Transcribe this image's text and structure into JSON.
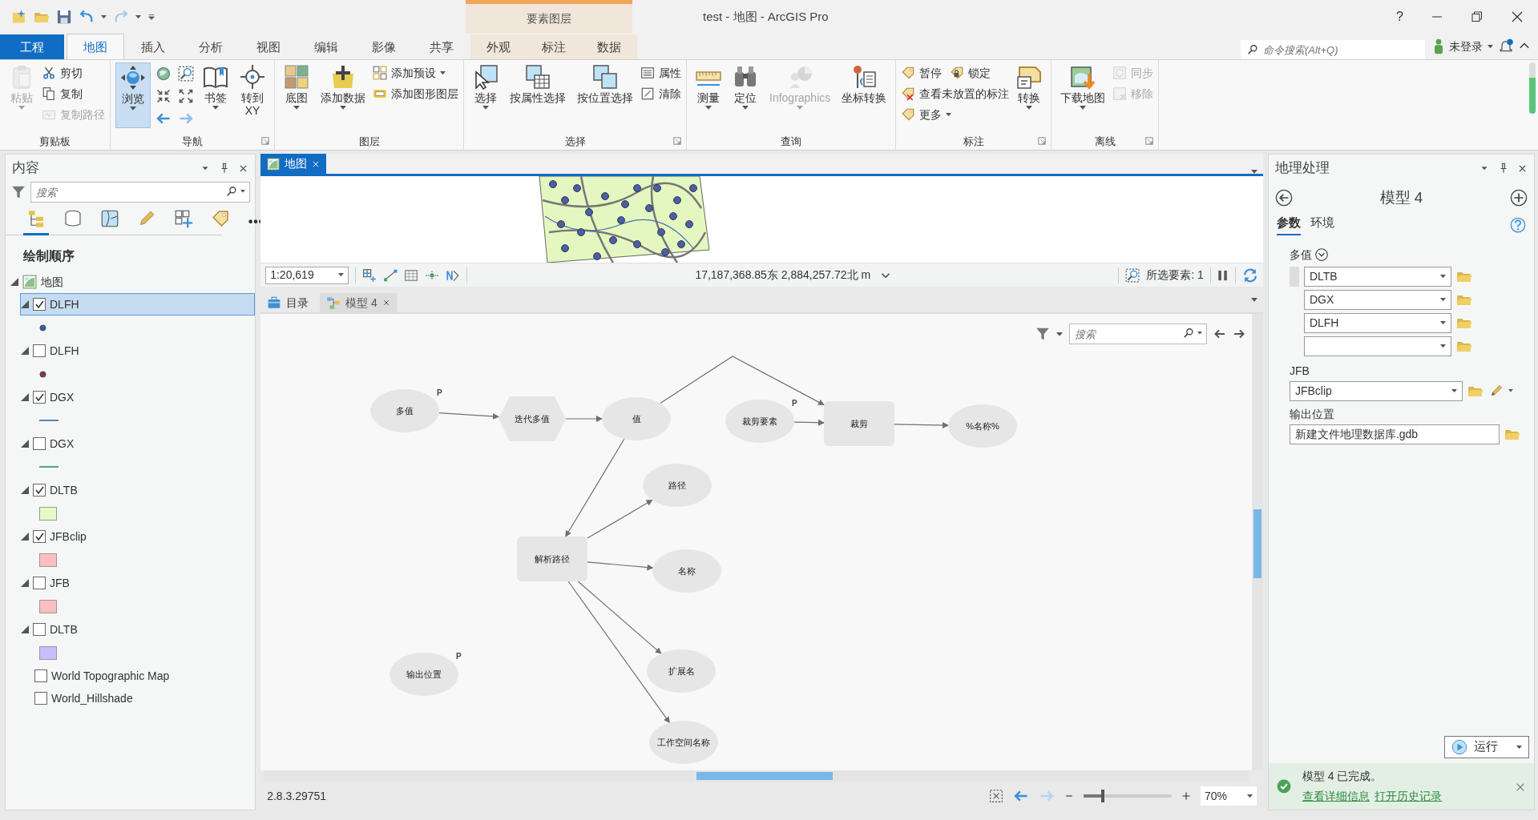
{
  "window": {
    "title": "test - 地图 - ArcGIS Pro",
    "context_group": "要素图层",
    "help": "?"
  },
  "ribbon_tabs": [
    {
      "label": "工程",
      "kind": "file",
      "selected": false
    },
    {
      "label": "地图",
      "kind": "tab",
      "selected": true
    },
    {
      "label": "插入",
      "kind": "tab",
      "selected": false
    },
    {
      "label": "分析",
      "kind": "tab",
      "selected": false
    },
    {
      "label": "视图",
      "kind": "tab",
      "selected": false
    },
    {
      "label": "编辑",
      "kind": "tab",
      "selected": false
    },
    {
      "label": "影像",
      "kind": "tab",
      "selected": false
    },
    {
      "label": "共享",
      "kind": "tab",
      "selected": false
    },
    {
      "label": "外观",
      "kind": "context",
      "selected": false
    },
    {
      "label": "标注",
      "kind": "context",
      "selected": false
    },
    {
      "label": "数据",
      "kind": "context",
      "selected": false
    }
  ],
  "command_search": {
    "placeholder": "命令搜索(Alt+Q)"
  },
  "account": {
    "label": "未登录"
  },
  "ribbon_groups": [
    {
      "title": "剪贴板",
      "launcher": false,
      "columns": [
        {
          "kind": "large",
          "command": {
            "label": "粘贴",
            "disabled": true,
            "active": false,
            "dropdown": true
          }
        },
        {
          "kind": "stack",
          "rows": [
            [
              {
                "label": "剪切",
                "disabled": false,
                "active": false,
                "dropdown": false
              }
            ],
            [
              {
                "label": "复制",
                "disabled": false,
                "active": false,
                "dropdown": false
              }
            ],
            [
              {
                "label": "复制路径",
                "disabled": true,
                "active": false,
                "dropdown": false
              }
            ]
          ]
        }
      ]
    },
    {
      "title": "导航",
      "launcher": true,
      "columns": [
        {
          "kind": "large",
          "command": {
            "label": "浏览",
            "disabled": false,
            "active": true,
            "dropdown": true
          }
        },
        {
          "kind": "grid",
          "items": [
            {
              "disabled": false
            },
            {
              "disabled": false
            },
            {
              "disabled": false
            },
            {
              "disabled": false
            },
            {
              "disabled": false
            },
            {
              "disabled": true
            }
          ]
        },
        {
          "kind": "large",
          "command": {
            "label": "书签",
            "disabled": false,
            "active": false,
            "dropdown": true
          }
        },
        {
          "kind": "large",
          "command": {
            "label": "转到 XY",
            "disabled": false,
            "active": false,
            "dropdown": false
          }
        }
      ]
    },
    {
      "title": "图层",
      "launcher": false,
      "columns": [
        {
          "kind": "large",
          "command": {
            "label": "底图",
            "disabled": false,
            "active": false,
            "dropdown": true
          }
        },
        {
          "kind": "large",
          "command": {
            "label": "添加数据",
            "disabled": false,
            "active": false,
            "dropdown": true
          }
        },
        {
          "kind": "stack",
          "rows": [
            [
              {
                "label": "添加预设",
                "disabled": false,
                "active": false,
                "dropdown": true
              }
            ],
            [
              {
                "label": "添加图形图层",
                "disabled": false,
                "active": false,
                "dropdown": false
              }
            ]
          ]
        }
      ]
    },
    {
      "title": "选择",
      "launcher": true,
      "columns": [
        {
          "kind": "large",
          "command": {
            "label": "选择",
            "disabled": false,
            "active": false,
            "dropdown": true
          }
        },
        {
          "kind": "large",
          "command": {
            "label": "按属性选择",
            "disabled": false,
            "active": false,
            "dropdown": false
          }
        },
        {
          "kind": "large",
          "command": {
            "label": "按位置选择",
            "disabled": false,
            "active": false,
            "dropdown": false
          }
        },
        {
          "kind": "stack",
          "rows": [
            [
              {
                "label": "属性",
                "disabled": false,
                "active": false,
                "dropdown": false
              }
            ],
            [
              {
                "label": "清除",
                "disabled": false,
                "active": false,
                "dropdown": false
              }
            ]
          ]
        }
      ]
    },
    {
      "title": "查询",
      "launcher": false,
      "columns": [
        {
          "kind": "large",
          "command": {
            "label": "测量",
            "disabled": false,
            "active": false,
            "dropdown": true
          }
        },
        {
          "kind": "large",
          "command": {
            "label": "定位",
            "disabled": false,
            "active": false,
            "dropdown": true
          }
        },
        {
          "kind": "large",
          "command": {
            "label": "Infographics",
            "disabled": true,
            "active": false,
            "dropdown": true
          }
        },
        {
          "kind": "large",
          "command": {
            "label": "坐标转换",
            "disabled": false,
            "active": false,
            "dropdown": false
          }
        }
      ]
    },
    {
      "title": "标注",
      "launcher": true,
      "columns": [
        {
          "kind": "stack",
          "rows": [
            [
              {
                "label": "暂停",
                "disabled": false,
                "active": false,
                "dropdown": false
              },
              {
                "label": "锁定",
                "disabled": false,
                "active": false,
                "dropdown": false
              }
            ],
            [
              {
                "label": "查看未放置的标注",
                "disabled": false,
                "active": false,
                "dropdown": false
              }
            ],
            [
              {
                "label": "更多",
                "disabled": false,
                "active": false,
                "dropdown": true
              }
            ]
          ]
        },
        {
          "kind": "large",
          "command": {
            "label": "转换",
            "disabled": false,
            "active": false,
            "dropdown": true
          }
        }
      ]
    },
    {
      "title": "离线",
      "launcher": true,
      "columns": [
        {
          "kind": "large",
          "command": {
            "label": "下载地图",
            "disabled": false,
            "active": false,
            "dropdown": true
          }
        },
        {
          "kind": "stack",
          "rows": [
            [
              {
                "label": "同步",
                "disabled": true,
                "active": false,
                "dropdown": false
              }
            ],
            [
              {
                "label": "移除",
                "disabled": true,
                "active": false,
                "dropdown": false
              }
            ]
          ]
        }
      ]
    }
  ],
  "contents_pane": {
    "title": "内容",
    "search": {
      "placeholder": "搜索"
    },
    "view_tabs": [
      {
        "selected": true
      },
      {
        "selected": false
      },
      {
        "selected": false
      },
      {
        "selected": false
      },
      {
        "selected": false
      },
      {
        "selected": false
      }
    ],
    "heading": "绘制顺序",
    "map": {
      "label": "地图",
      "expanded": true
    },
    "layers": [
      {
        "kind": "layer",
        "name": "DLFH",
        "checked": true,
        "selected": true,
        "expanded": true,
        "symbol": {
          "kind": "point",
          "color": "#3b5ca6"
        }
      },
      {
        "kind": "layer",
        "name": "DLFH",
        "checked": false,
        "selected": false,
        "expanded": true,
        "symbol": {
          "kind": "point",
          "color": "#8a2f64"
        }
      },
      {
        "kind": "layer",
        "name": "DGX",
        "checked": true,
        "selected": false,
        "expanded": true,
        "symbol": {
          "kind": "line",
          "color": "#5b84b8"
        }
      },
      {
        "kind": "layer",
        "name": "DGX",
        "checked": false,
        "selected": false,
        "expanded": true,
        "symbol": {
          "kind": "line",
          "color": "#4fa67c"
        }
      },
      {
        "kind": "layer",
        "name": "DLTB",
        "checked": true,
        "selected": false,
        "expanded": true,
        "symbol": {
          "kind": "fill",
          "color": "#e5fbc2"
        }
      },
      {
        "kind": "layer",
        "name": "JFBclip",
        "checked": true,
        "selected": false,
        "expanded": true,
        "symbol": {
          "kind": "fill",
          "color": "#ffbebe"
        }
      },
      {
        "kind": "layer",
        "name": "JFB",
        "checked": false,
        "selected": false,
        "expanded": true,
        "symbol": {
          "kind": "fill",
          "color": "#ffbebe"
        }
      },
      {
        "kind": "layer",
        "name": "DLTB",
        "checked": false,
        "selected": false,
        "expanded": true,
        "symbol": {
          "kind": "fill",
          "color": "#c9bdff"
        }
      },
      {
        "kind": "basemap",
        "name": "World Topographic Map",
        "checked": false,
        "selected": false
      },
      {
        "kind": "basemap",
        "name": "World_Hillshade",
        "checked": false,
        "selected": false
      }
    ]
  },
  "map_view": {
    "tab": {
      "label": "地图",
      "selected": true
    },
    "scale": "1:20,619",
    "coordinates": "17,187,368.85东 2,884,257.72北 m",
    "selected_features": "所选要素: 1"
  },
  "view_tabs": [
    {
      "label": "目录",
      "selected": false,
      "closable": false
    },
    {
      "label": "模型 4",
      "selected": true,
      "closable": true
    }
  ],
  "model_view": {
    "search": {
      "placeholder": "搜索"
    },
    "nodes": [
      {
        "label": "多值",
        "kind": "variable",
        "parameter": "P"
      },
      {
        "label": "迭代多值",
        "kind": "iterator"
      },
      {
        "label": "值",
        "kind": "variable"
      },
      {
        "label": "裁剪要素",
        "kind": "variable",
        "parameter": "P"
      },
      {
        "label": "裁剪",
        "kind": "tool"
      },
      {
        "label": "%名称%",
        "kind": "variable"
      },
      {
        "label": "路径",
        "kind": "variable"
      },
      {
        "label": "解析路径",
        "kind": "tool"
      },
      {
        "label": "名称",
        "kind": "variable"
      },
      {
        "label": "扩展名",
        "kind": "variable"
      },
      {
        "label": "工作空间名称",
        "kind": "variable"
      },
      {
        "label": "输出位置",
        "kind": "variable",
        "parameter": "P"
      }
    ],
    "version": "2.8.3.29751",
    "zoom": {
      "level": 0.22,
      "reading": "70%"
    }
  },
  "geoprocessing": {
    "title": "地理处理",
    "tool_title": "模型 4",
    "tabs": [
      {
        "label": "参数",
        "selected": true
      },
      {
        "label": "环境",
        "selected": false
      }
    ],
    "parameters": [
      {
        "kind": "multivalue",
        "label": "多值",
        "expanded": true,
        "values": [
          {
            "kind": "value",
            "value": "DLTB"
          },
          {
            "kind": "value",
            "value": "DGX"
          },
          {
            "kind": "value",
            "value": "DLFH"
          },
          {
            "kind": "blank"
          }
        ]
      },
      {
        "kind": "dropdown",
        "label": "JFB",
        "value": "JFBclip"
      },
      {
        "kind": "text",
        "label": "输出位置",
        "value": "新建文件地理数据库.gdb"
      }
    ],
    "run": {
      "label": "运行"
    },
    "message": {
      "text": "模型 4 已完成。",
      "links": [
        "查看详细信息",
        "打开历史记录"
      ]
    }
  }
}
